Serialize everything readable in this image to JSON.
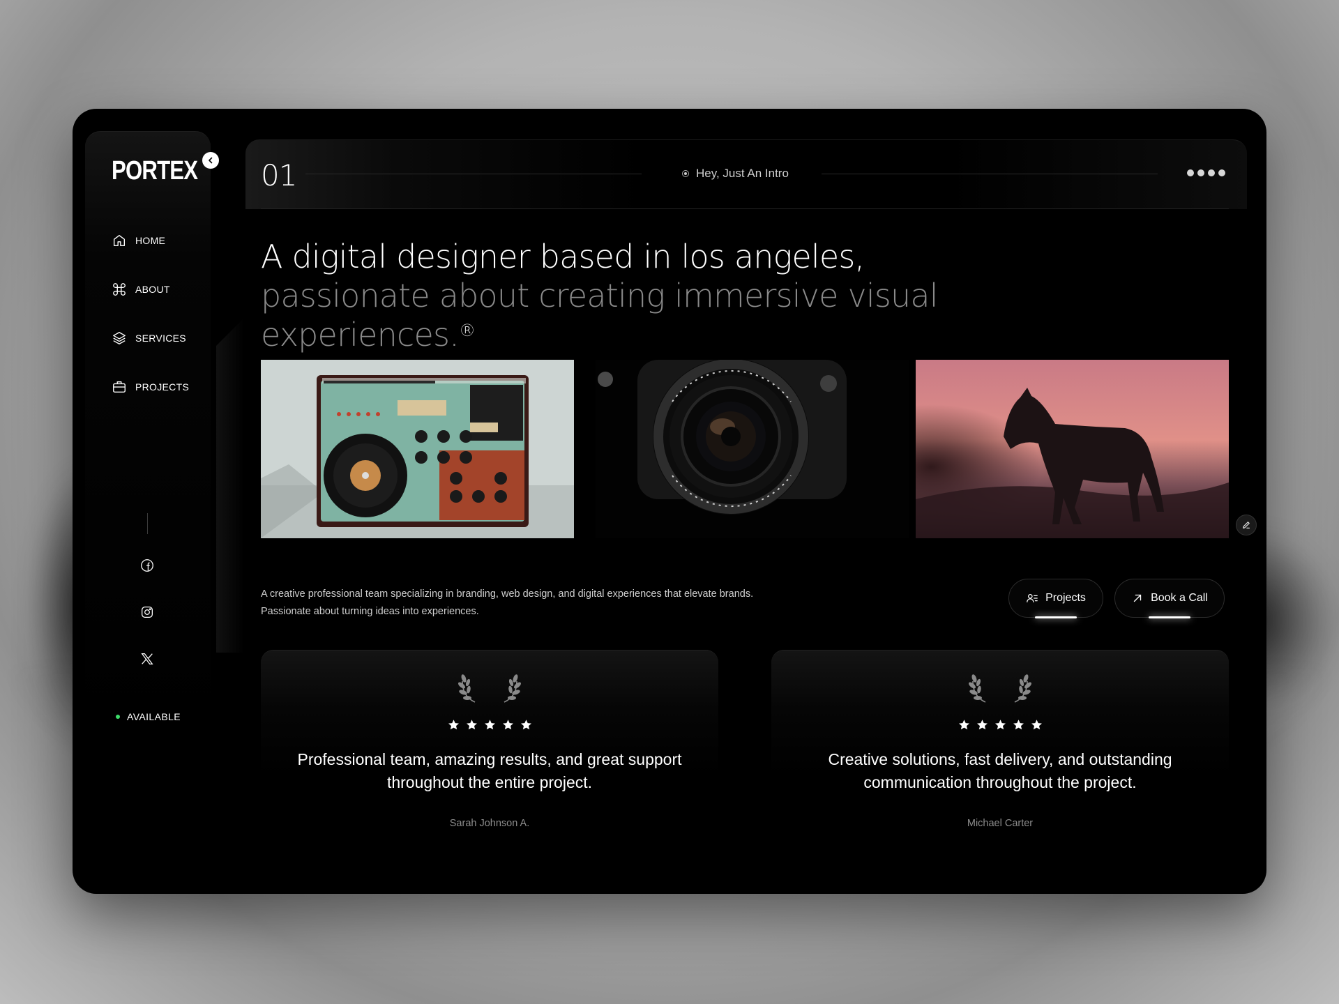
{
  "brand": {
    "logo": "PORTEX",
    "collapse_icon": "chevron-left-icon"
  },
  "sidebar": {
    "items": [
      {
        "label": "HOME",
        "icon": "home-icon"
      },
      {
        "label": "ABOUT",
        "icon": "command-icon"
      },
      {
        "label": "SERVICES",
        "icon": "layers-icon"
      },
      {
        "label": "PROJECTS",
        "icon": "briefcase-icon"
      }
    ],
    "social": [
      {
        "icon": "facebook-icon"
      },
      {
        "icon": "instagram-icon"
      },
      {
        "icon": "x-icon"
      }
    ],
    "status": {
      "label": "AVAILABLE",
      "color": "#3ddc6a"
    }
  },
  "header": {
    "section_number": "01",
    "intro_label": "Hey, Just An Intro",
    "menu_icon": "dots-icon"
  },
  "hero": {
    "headline_main": "A digital designer based in los angeles, ",
    "headline_muted": "passionate about creating immersive visual experiences.",
    "registered": "®"
  },
  "gallery": [
    {
      "alt": "turntable"
    },
    {
      "alt": "camera lens"
    },
    {
      "alt": "horse silhouette"
    }
  ],
  "description": {
    "line1": "A creative professional team specializing in branding, web design, and digital experiences that elevate brands.",
    "line2": "Passionate about turning ideas into experiences."
  },
  "actions": {
    "projects_label": "Projects",
    "call_label": "Book a Call"
  },
  "testimonials": [
    {
      "rating": 5,
      "quote": "Professional team, amazing results, and great support throughout the entire project.",
      "author": "Sarah Johnson A."
    },
    {
      "rating": 5,
      "quote": "Creative solutions, fast delivery, and outstanding communication throughout the project.",
      "author": "Michael Carter"
    }
  ],
  "colors": {
    "background": "#000000",
    "text": "#ffffff",
    "muted": "#8a8a8a",
    "accent_green": "#3ddc6a"
  }
}
